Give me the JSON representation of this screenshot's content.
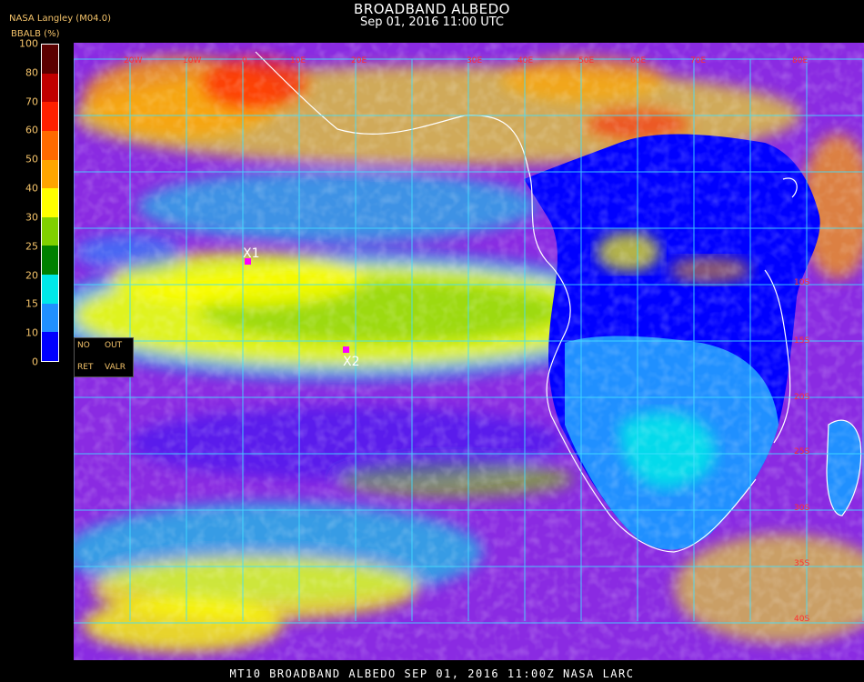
{
  "header": {
    "title": "BROADBAND ALBEDO",
    "subtitle": "Sep 01, 2016 11:00 UTC",
    "source": "NASA Langley (M04.0)",
    "unit_label": "BBALB (%)"
  },
  "colorbar": {
    "labels": [
      "100",
      "80",
      "70",
      "60",
      "50",
      "40",
      "30",
      "25",
      "20",
      "15",
      "10",
      "0"
    ],
    "colors": [
      "#5a0000",
      "#c00000",
      "#ff2000",
      "#ff6a00",
      "#ffa500",
      "#ffff00",
      "#80d000",
      "#008000",
      "#00e8e8",
      "#2090ff",
      "#0000ff",
      "#8a2be2"
    ]
  },
  "legend_box": {
    "no": "NO",
    "out": "OUT",
    "ret": "RET",
    "valr": "VALR"
  },
  "map": {
    "colors": {
      "purple": "#8a2be2",
      "dark_blue": "#0000ff",
      "mid_blue": "#2090ff",
      "cyan": "#00e8e8",
      "green": "#008000",
      "lime": "#80d000",
      "yellow": "#ffff00",
      "orange": "#ffa500",
      "red": "#ff2000",
      "grid": "#40e0ff",
      "grid_label": "#ff3030",
      "coast": "#ffffff",
      "marker": "#ff00ff"
    },
    "lon_labels": [
      "20W",
      "10W",
      "0",
      "10E",
      "20E",
      "30E",
      "40E",
      "50E",
      "60E",
      "70E",
      "80E"
    ],
    "lat_labels": [
      "10S",
      "15S",
      "20S",
      "25S",
      "30S",
      "35S",
      "40S"
    ],
    "markers": [
      {
        "label": "X1"
      },
      {
        "label": "X2"
      }
    ]
  },
  "footer": {
    "text": "MT10  BROADBAND ALBEDO   SEP 01, 2016 11:00Z   NASA LARC"
  }
}
